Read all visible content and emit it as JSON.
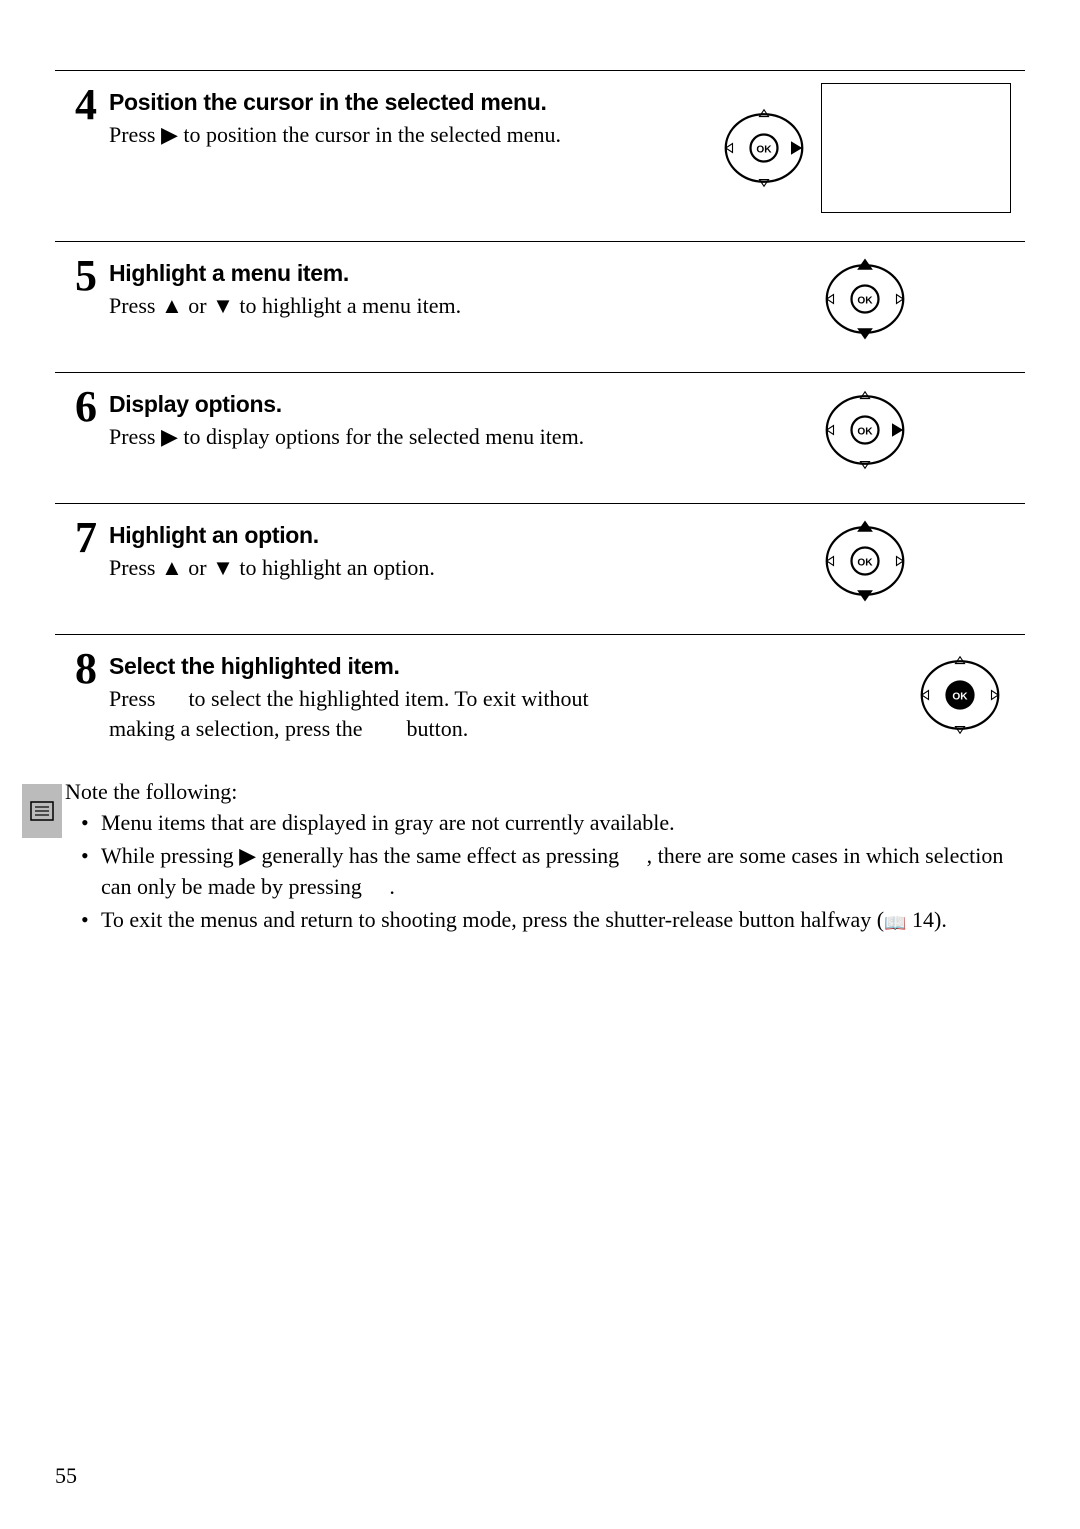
{
  "page_number": "55",
  "note_intro": "Note the following:",
  "steps": [
    {
      "num": "4",
      "title": "Position the cursor in the selected menu.",
      "text_before": "Press ",
      "glyph": "▶",
      "text_after": " to position the cursor in the selected menu.",
      "dpad": "right",
      "has_screenshot": true
    },
    {
      "num": "5",
      "title": "Highlight a menu item.",
      "text_before": "Press ",
      "glyph": "▲",
      "text_mid": " or ",
      "glyph2": "▼",
      "text_after": " to highlight a menu item.",
      "dpad": "updown"
    },
    {
      "num": "6",
      "title": "Display options.",
      "text_before": "Press ",
      "glyph": "▶",
      "text_after": " to display options for the selected menu item.",
      "dpad": "right"
    },
    {
      "num": "7",
      "title": "Highlight an option.",
      "text_before": "Press ",
      "glyph": "▲",
      "text_mid": " or ",
      "glyph2": "▼",
      "text_after": " to highlight an option.",
      "dpad": "updown"
    },
    {
      "num": "8",
      "title": "Select the highlighted item.",
      "text_full": "Press      to select the highlighted item.  To exit without making a selection, press the        button.",
      "dpad": "ok"
    }
  ],
  "bullets": [
    {
      "text": "Menu items that are displayed in gray are not currently available."
    },
    {
      "pre": "While pressing ",
      "glyph": "▶",
      "mid": " generally has the same effect as pressing     , there are some cases in which selection can only be made by pressing     ."
    },
    {
      "pre": "To exit the menus and return to shooting mode, press the shutter-release button halfway (",
      "book": "⌂",
      "page": " 14)."
    }
  ]
}
